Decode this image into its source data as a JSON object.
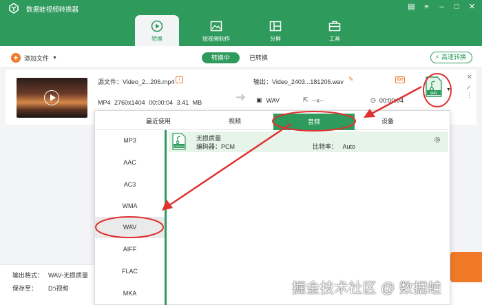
{
  "app": {
    "title": "数据蛙视频转换器"
  },
  "nav": {
    "tabs": [
      {
        "label": "转换"
      },
      {
        "label": "短视频制作"
      },
      {
        "label": "分屏"
      },
      {
        "label": "工具"
      }
    ]
  },
  "toolbar": {
    "add_file": "添加文件",
    "converting": "转换中",
    "converted": "已转换",
    "fast_convert": "高速转换"
  },
  "file": {
    "source_name": "源文件：Video_2...206.mp4",
    "source_format": "MP4",
    "source_resolution": "2760x1404",
    "source_duration": "00:00:04",
    "source_size": "3.41 MB",
    "output_name": "输出：Video_2403...181206.wav",
    "output_format": "WAV",
    "output_resolution": "--x--",
    "output_duration": "00:00:04",
    "badge_id3": "ID3",
    "format_icon_text": "WAV"
  },
  "popup": {
    "tabs": [
      {
        "label": "最近使用"
      },
      {
        "label": "视频"
      },
      {
        "label": "音频"
      },
      {
        "label": "设备"
      }
    ],
    "active_tab": "音频",
    "formats": [
      "MP3",
      "AAC",
      "AC3",
      "WMA",
      "WAV",
      "AIFF",
      "FLAC",
      "MKA"
    ],
    "selected_format": "WAV",
    "detail": {
      "icon_text": "LOSSLESS",
      "title": "无损质量",
      "encoder": "编码器：PCM",
      "bitrate_label": "比特率：",
      "bitrate_value": "Auto"
    }
  },
  "bottom": {
    "output_format_label": "输出格式：",
    "output_format_value": "WAV-无损质量",
    "save_to_label": "保存至：",
    "save_to_value": "D:\\视频"
  },
  "watermark": "掘金技术社区 @ 数据蛙",
  "colors": {
    "brand": "#2e9a5c",
    "accent": "#f07a28",
    "annotation": "#e03030"
  }
}
